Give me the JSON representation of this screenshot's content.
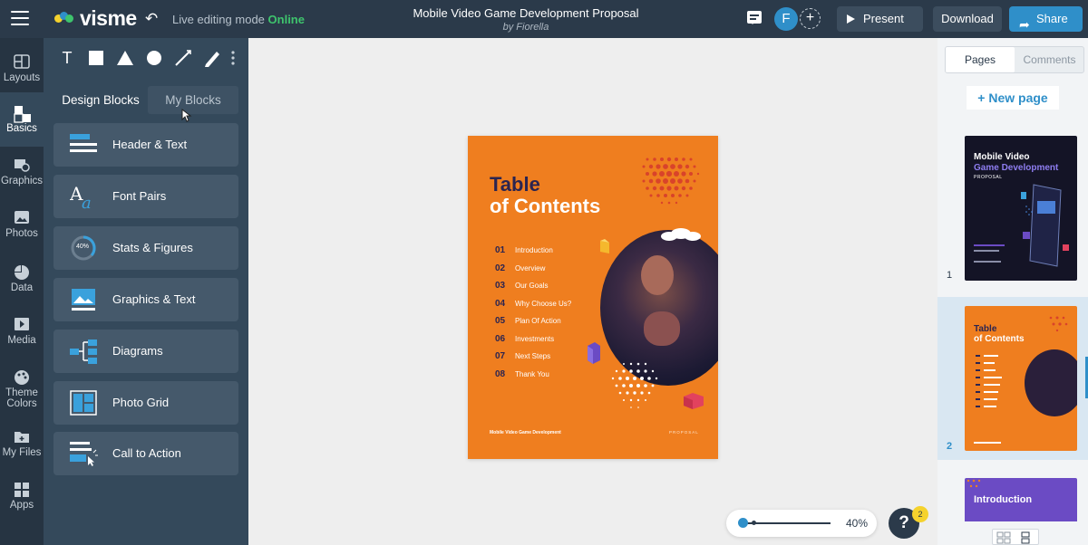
{
  "topbar": {
    "logo_text": "visme",
    "live_mode_label": "Live editing mode",
    "live_status": "Online",
    "doc_title": "Mobile Video Game Development Proposal",
    "doc_author": "by Fiorella",
    "avatar_initial": "F",
    "present_label": "Present",
    "download_label": "Download",
    "share_label": "Share"
  },
  "rail": {
    "items": [
      {
        "label": "Layouts",
        "icon": "layouts-icon"
      },
      {
        "label": "Basics",
        "icon": "basics-icon"
      },
      {
        "label": "Graphics",
        "icon": "graphics-icon"
      },
      {
        "label": "Photos",
        "icon": "photos-icon"
      },
      {
        "label": "Data",
        "icon": "data-icon"
      },
      {
        "label": "Media",
        "icon": "media-icon"
      },
      {
        "label": "Theme Colors",
        "icon": "palette-icon"
      },
      {
        "label": "My Files",
        "icon": "files-icon"
      },
      {
        "label": "Apps",
        "icon": "apps-icon"
      }
    ]
  },
  "panel": {
    "tools": [
      "T"
    ],
    "tabs": {
      "design_blocks": "Design Blocks",
      "my_blocks": "My Blocks"
    },
    "blocks": [
      {
        "label": "Header & Text"
      },
      {
        "label": "Font Pairs"
      },
      {
        "label": "Stats & Figures",
        "badge": "40%"
      },
      {
        "label": "Graphics & Text"
      },
      {
        "label": "Diagrams"
      },
      {
        "label": "Photo Grid"
      },
      {
        "label": "Call to Action"
      }
    ]
  },
  "slide": {
    "title_line1": "Table",
    "title_line2": "of Contents",
    "toc": [
      {
        "num": "01",
        "label": "Introduction"
      },
      {
        "num": "02",
        "label": "Overview"
      },
      {
        "num": "03",
        "label": "Our Goals"
      },
      {
        "num": "04",
        "label": "Why Choose Us?"
      },
      {
        "num": "05",
        "label": "Plan Of Action"
      },
      {
        "num": "06",
        "label": "Investments"
      },
      {
        "num": "07",
        "label": "Next Steps"
      },
      {
        "num": "08",
        "label": "Thank You"
      }
    ],
    "footer_left": "Mobile Video Game Development",
    "footer_right": "PROPOSAL"
  },
  "pages_panel": {
    "tab_pages": "Pages",
    "tab_comments": "Comments",
    "new_page_label": "+ New page",
    "thumb1": {
      "number": "1",
      "title": "Mobile Video",
      "subtitle": "Game Development",
      "tag": "PROPOSAL"
    },
    "thumb2": {
      "number": "2",
      "title_line1": "Table",
      "title_line2": "of Contents"
    },
    "thumb3": {
      "title": "Introduction"
    }
  },
  "zoom": {
    "label": "40%",
    "value": 0.4
  },
  "help": {
    "label": "?",
    "badge": "2"
  },
  "colors": {
    "topbar": "#2b3a4a",
    "accent": "#2f8fc9",
    "online": "#3ec46d",
    "slide_orange": "#ef7e1f",
    "slide_navy": "#2b2450"
  }
}
